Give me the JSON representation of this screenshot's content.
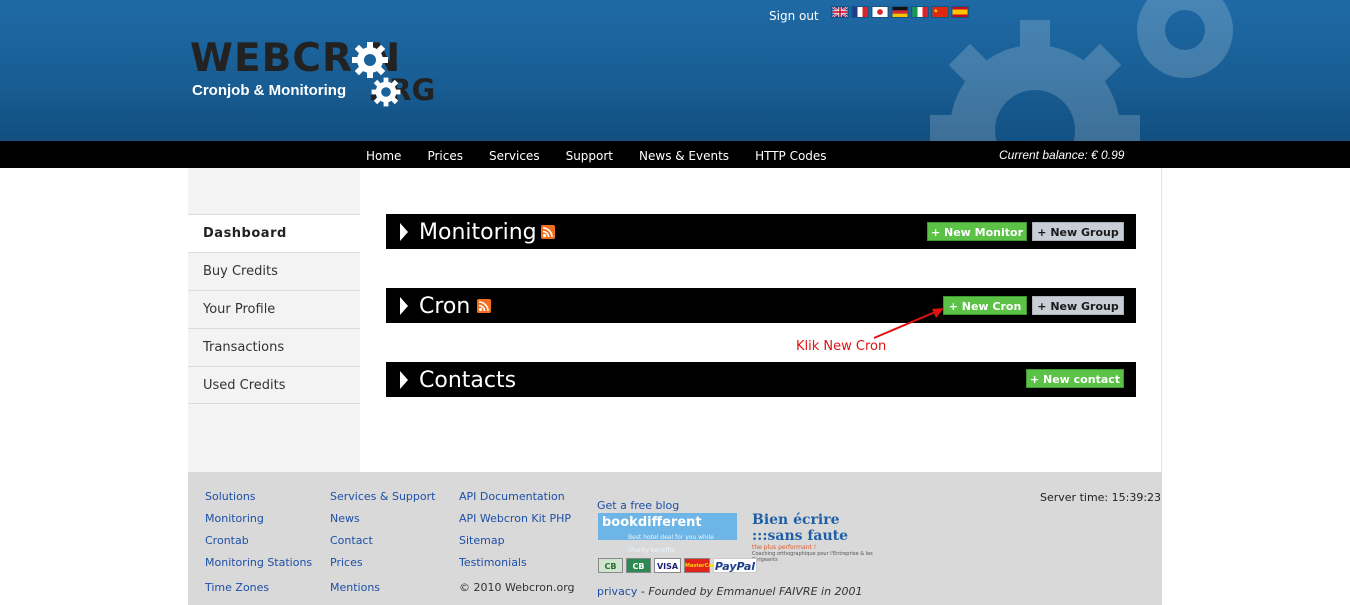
{
  "header": {
    "sign_out": "Sign out",
    "flags": [
      "flag-uk-icon",
      "flag-france-icon",
      "flag-japan-icon",
      "flag-germany-icon",
      "flag-italy-icon",
      "flag-china-icon",
      "flag-spain-icon"
    ],
    "logo_word": "WEBCR  N",
    "logo_org": ".  RG",
    "logo_tagline": "Cronjob & Monitoring"
  },
  "nav": {
    "items": [
      "Home",
      "Prices",
      "Services",
      "Support",
      "News & Events",
      "HTTP Codes"
    ],
    "balance": "Current balance: € 0.99"
  },
  "sidebar": {
    "items": [
      "Dashboard",
      "Buy Credits",
      "Your Profile",
      "Transactions",
      "Used Credits"
    ]
  },
  "sections": {
    "monitoring": {
      "title": "Monitoring",
      "new_button": "+ New Monitor",
      "group_button": "+ New Group"
    },
    "cron": {
      "title": "Cron",
      "new_button": "+ New Cron",
      "group_button": "+ New Group"
    },
    "contacts": {
      "title": "Contacts",
      "new_button": "+ New contact"
    }
  },
  "annotation": "Klik New Cron",
  "footer": {
    "col1": [
      "Solutions",
      "Monitoring",
      "Crontab",
      "Monitoring Stations",
      "Time Zones"
    ],
    "col2": [
      "Services & Support",
      "News",
      "Contact",
      "Prices",
      "Mentions"
    ],
    "col3": [
      "API Documentation",
      "API Webcron Kit PHP",
      "Sitemap",
      "Testimonials",
      "© 2010 Webcron.org"
    ],
    "blog": "Get a free blog",
    "bookdifferent": "bookdifferent",
    "bookdifferent_sub": "Best hotel deal for you while charity benefits",
    "bienecrire": "Bien écrire :::sans faute",
    "bienecrire_tag": "the plus performant !",
    "bienecrire_sub": "Coaching orthographique pour l'Entreprise & les Dirigeants",
    "payments": [
      "CB",
      "CB",
      "VISA",
      "MasterCard",
      "PayPal"
    ],
    "privacy": "privacy",
    "founded": "Founded by Emmanuel FAIVRE in 2001",
    "server_time": "Server time: 15:39:23"
  },
  "colors": {
    "header_blue": "#1a629c",
    "accent_green": "#5bc247",
    "annotation_red": "#e01212",
    "link_blue": "#1d4fa6"
  }
}
